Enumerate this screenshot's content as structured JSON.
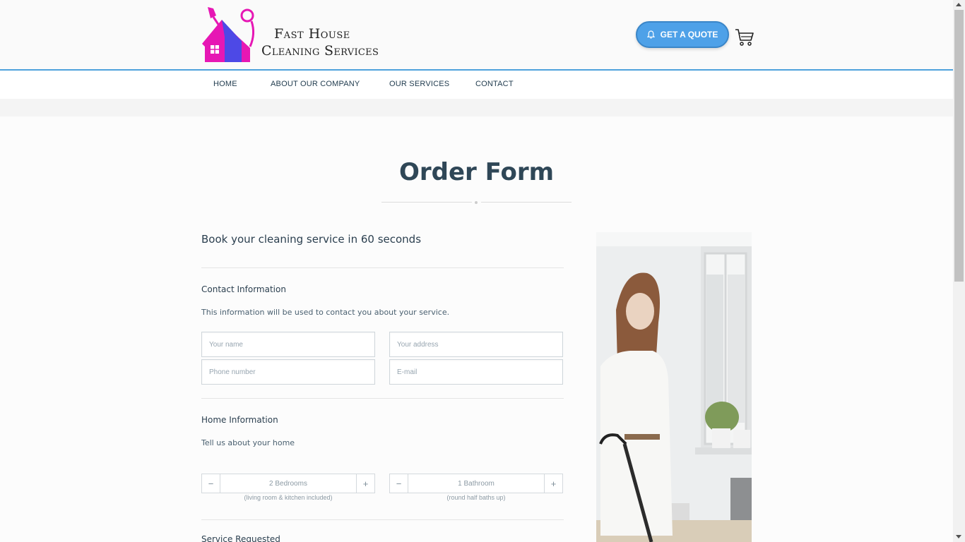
{
  "brand": {
    "line1": "Fast House",
    "line2": "Cleaning Services",
    "colors": {
      "magenta": "#e617b4",
      "blue": "#4d49e6"
    }
  },
  "header": {
    "quote_button": "GET A QUOTE",
    "bell_icon": "bell-icon",
    "cart_icon": "cart-icon"
  },
  "nav": {
    "items": [
      {
        "label": "HOME"
      },
      {
        "label": "ABOUT OUR COMPANY"
      },
      {
        "label": "OUR SERVICES"
      },
      {
        "label": "CONTACT"
      }
    ]
  },
  "main": {
    "title": "Order Form",
    "subtitle": "Book your cleaning service in 60 seconds",
    "contact": {
      "title": "Contact Information",
      "desc": "This information will be used to contact you about your service.",
      "name_placeholder": "Your name",
      "address_placeholder": "Your address",
      "phone_placeholder": "Phone number",
      "email_placeholder": "E-mail"
    },
    "home": {
      "title": "Home Information",
      "desc": "Tell us about your home",
      "bedrooms": {
        "minus": "−",
        "value": "2 Bedrooms",
        "plus": "+",
        "note": "(living room & kitchen included)"
      },
      "bathrooms": {
        "minus": "−",
        "value": "1 Bathroom",
        "plus": "+",
        "note": "(round half baths up)"
      }
    },
    "service": {
      "title": "Service Requested"
    }
  },
  "accent_color": "#4ea1e8"
}
